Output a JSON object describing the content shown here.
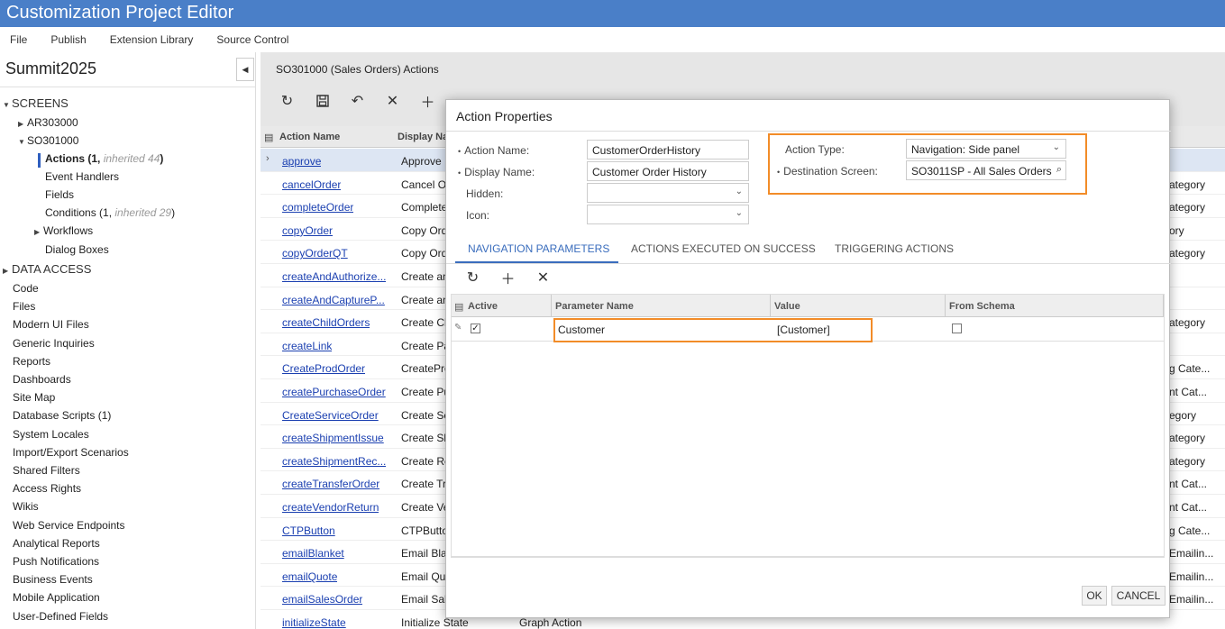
{
  "app": {
    "title": "Customization Project Editor"
  },
  "menu": [
    "File",
    "Publish",
    "Extension Library",
    "Source Control"
  ],
  "project": {
    "name": "Summit2025"
  },
  "tree": {
    "screens_label": "SCREENS",
    "ar_node": "AR303000",
    "so_node": "SO301000",
    "actions_label": "Actions (1, ",
    "actions_inherited": "inherited 44",
    "actions_close": ")",
    "event_handlers": "Event Handlers",
    "fields": "Fields",
    "conditions_label": "Conditions (1, ",
    "conditions_inherited": "inherited 29",
    "conditions_close": ")",
    "workflows": "Workflows",
    "dialog_boxes": "Dialog Boxes",
    "data_access": "DATA ACCESS",
    "items": [
      "Code",
      "Files",
      "Modern UI Files",
      "Generic Inquiries",
      "Reports",
      "Dashboards",
      "Site Map",
      "Database Scripts (1)",
      "System Locales",
      "Import/Export Scenarios",
      "Shared Filters",
      "Access Rights",
      "Wikis",
      "Web Service Endpoints",
      "Analytical Reports",
      "Push Notifications",
      "Business Events",
      "Mobile Application",
      "User-Defined Fields"
    ]
  },
  "main": {
    "title": "SO301000 (Sales Orders) Actions",
    "col_action_name": "Action Name",
    "col_display_name": "Display Na",
    "rows": [
      {
        "name": "approve",
        "display": "Approve",
        "type": "",
        "cat": ""
      },
      {
        "name": "cancelOrder",
        "display": "Cancel O",
        "type": "",
        "cat": "ategory"
      },
      {
        "name": "completeOrder",
        "display": "Complete",
        "type": "",
        "cat": "ategory"
      },
      {
        "name": "copyOrder",
        "display": "Copy Ord",
        "type": "",
        "cat": "ory"
      },
      {
        "name": "copyOrderQT",
        "display": "Copy Ord",
        "type": "",
        "cat": "ategory"
      },
      {
        "name": "createAndAuthorize...",
        "display": "Create an",
        "type": "",
        "cat": ""
      },
      {
        "name": "createAndCaptureP...",
        "display": "Create an",
        "type": "",
        "cat": ""
      },
      {
        "name": "createChildOrders",
        "display": "Create Ch",
        "type": "",
        "cat": "ategory"
      },
      {
        "name": "createLink",
        "display": "Create Pa",
        "type": "",
        "cat": ""
      },
      {
        "name": "CreateProdOrder",
        "display": "CreatePro",
        "type": "",
        "cat": "g Cate..."
      },
      {
        "name": "createPurchaseOrder",
        "display": "Create Pu",
        "type": "",
        "cat": "nt Cat..."
      },
      {
        "name": "CreateServiceOrder",
        "display": "Create Se",
        "type": "",
        "cat": "egory"
      },
      {
        "name": "createShipmentIssue",
        "display": "Create Sh",
        "type": "",
        "cat": "ategory"
      },
      {
        "name": "createShipmentRec...",
        "display": "Create Re",
        "type": "",
        "cat": "ategory"
      },
      {
        "name": "createTransferOrder",
        "display": "Create Tr",
        "type": "",
        "cat": "nt Cat..."
      },
      {
        "name": "createVendorReturn",
        "display": "Create Ve",
        "type": "",
        "cat": "nt Cat..."
      },
      {
        "name": "CTPButton",
        "display": "CTPButto",
        "type": "",
        "cat": "g Cate..."
      },
      {
        "name": "emailBlanket",
        "display": "Email Bla",
        "type": "",
        "cat": "Emailin..."
      },
      {
        "name": "emailQuote",
        "display": "Email Quo",
        "type": "",
        "cat": "Emailin..."
      },
      {
        "name": "emailSalesOrder",
        "display": "Email Sal",
        "type": "",
        "cat": "Emailin..."
      },
      {
        "name": "initializeState",
        "display": "Initialize State",
        "type": "Graph Action",
        "cat": ""
      }
    ]
  },
  "dialog": {
    "title": "Action Properties",
    "action_name_label": "Action Name:",
    "action_name_value": "CustomerOrderHistory",
    "display_name_label": "Display Name:",
    "display_name_value": "Customer Order History",
    "hidden_label": "Hidden:",
    "icon_label": "Icon:",
    "action_type_label": "Action Type:",
    "action_type_value": "Navigation: Side panel",
    "destination_label": "Destination Screen:",
    "destination_value": "SO3011SP - All Sales Orders",
    "tabs": [
      "NAVIGATION PARAMETERS",
      "ACTIONS EXECUTED ON SUCCESS",
      "TRIGGERING ACTIONS"
    ],
    "params": {
      "col_active": "Active",
      "col_param": "Parameter Name",
      "col_value": "Value",
      "col_schema": "From Schema",
      "row": {
        "active": true,
        "param": "Customer",
        "value": "[Customer]",
        "from_schema": false
      }
    },
    "ok_label": "OK",
    "cancel_label": "CANCEL"
  },
  "colors": {
    "titlebar": "#4a7fc8",
    "highlight": "#f28c28",
    "link": "#1a3fb0",
    "tab_active": "#3a6dbd"
  }
}
